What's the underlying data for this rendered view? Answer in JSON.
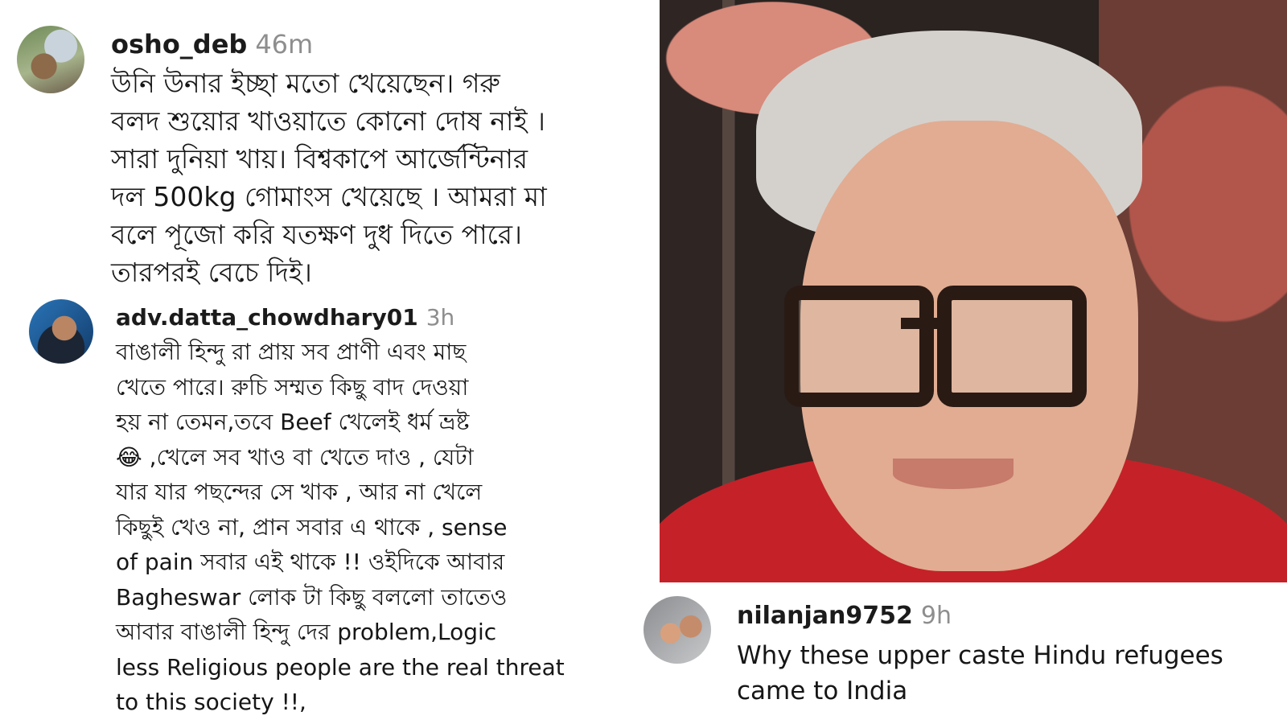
{
  "comments": [
    {
      "username": "osho_deb",
      "time": "46m",
      "text": "উনি উনার ইচ্ছা মতো খেয়েছেন। গরু\nবলদ শুয়োর খাওয়াতে কোনো দোষ নাই ।\nসারা দুনিয়া খায়। বিশ্বকাপে আর্জেন্টিনার\nদল 500kg গোমাংস খেয়েছে । আমরা মা\nবলে পূজো করি যতক্ষণ দুধ দিতে পারে।\nতারপরই বেচে দিই।"
    },
    {
      "username": "adv.datta_chowdhary01",
      "time": "3h",
      "text": "বাঙালী হিন্দু রা প্রায় সব প্রাণী এবং মাছ\nখেতে পারে। রুচি সম্মত কিছু বাদ দেওয়া\nহয় না তেমন,তবে Beef খেলেই ধর্ম ভ্রষ্ট\n😂 ,খেলে সব খাও বা খেতে দাও , যেটা\nযার যার পছন্দের সে খাক , আর না খেলে\nকিছুই খেও না, প্রান সবার এ থাকে , sense\nof pain সবার এই থাকে !! ওইদিকে আবার\nBagheswar লোক টা কিছু বললো তাতেও\nআবার বাঙালী হিন্দু দের problem,Logic\nless Religious people are the real threat\nto this society !!,"
    },
    {
      "username": "nilanjan9752",
      "time": "9h",
      "text": "Why these upper caste Hindu refugees\ncame to India"
    }
  ]
}
